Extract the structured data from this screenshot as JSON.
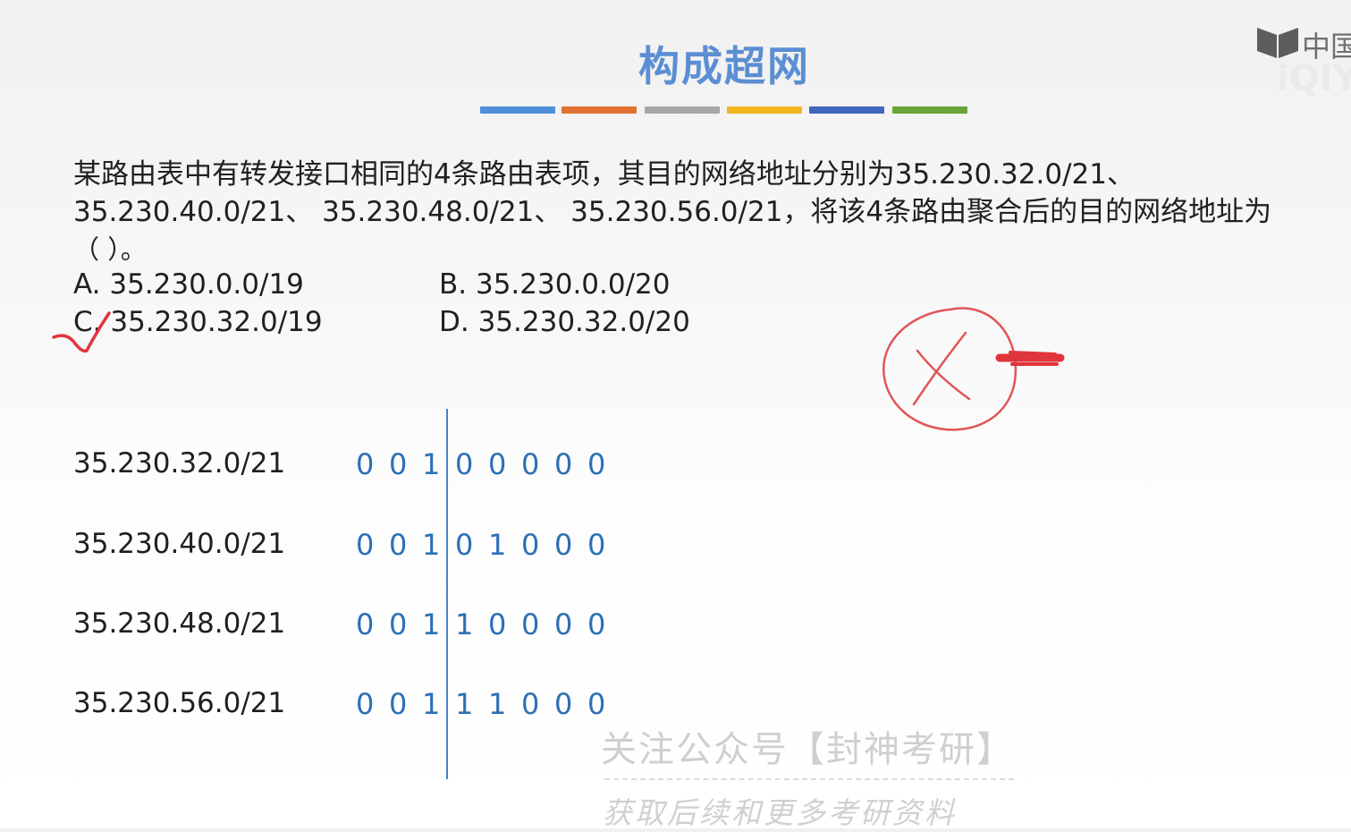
{
  "title": "构成超网",
  "color_bars": [
    "#4f8fd7",
    "#e07332",
    "#a6a6a6",
    "#f2b520",
    "#3f67bd",
    "#6ba437"
  ],
  "question": {
    "line1": "某路由表中有转发接口相同的4条路由表项，其目的网络地址分别为35.230.32.0/21、",
    "line2": "35.230.40.0/21、 35.230.48.0/21、 35.230.56.0/21，将该4条路由聚合后的目的网络地址为",
    "line3": "（        ）。"
  },
  "options": {
    "a": "A.   35.230.0.0/19",
    "b": "B.   35.230.0.0/20",
    "c": "C.   35.230.32.0/19",
    "d": "D.   35.230.32.0/20"
  },
  "rows": [
    {
      "addr": "35.230.32.0/21",
      "bits": [
        "0",
        "0",
        "1",
        "0",
        "0",
        "0",
        "0",
        "0"
      ]
    },
    {
      "addr": "35.230.40.0/21",
      "bits": [
        "0",
        "0",
        "1",
        "0",
        "1",
        "0",
        "0",
        "0"
      ]
    },
    {
      "addr": "35.230.48.0/21",
      "bits": [
        "0",
        "0",
        "1",
        "1",
        "0",
        "0",
        "0",
        "0"
      ]
    },
    {
      "addr": "35.230.56.0/21",
      "bits": [
        "0",
        "0",
        "1",
        "1",
        "1",
        "0",
        "0",
        "0"
      ]
    }
  ],
  "watermark": {
    "line1": "关注公众号【封神考研】",
    "line2": "获取后续和更多考研资料"
  },
  "logo": {
    "top": "中国",
    "bottom": "iQIY"
  },
  "annotation_color": "#e0353c"
}
